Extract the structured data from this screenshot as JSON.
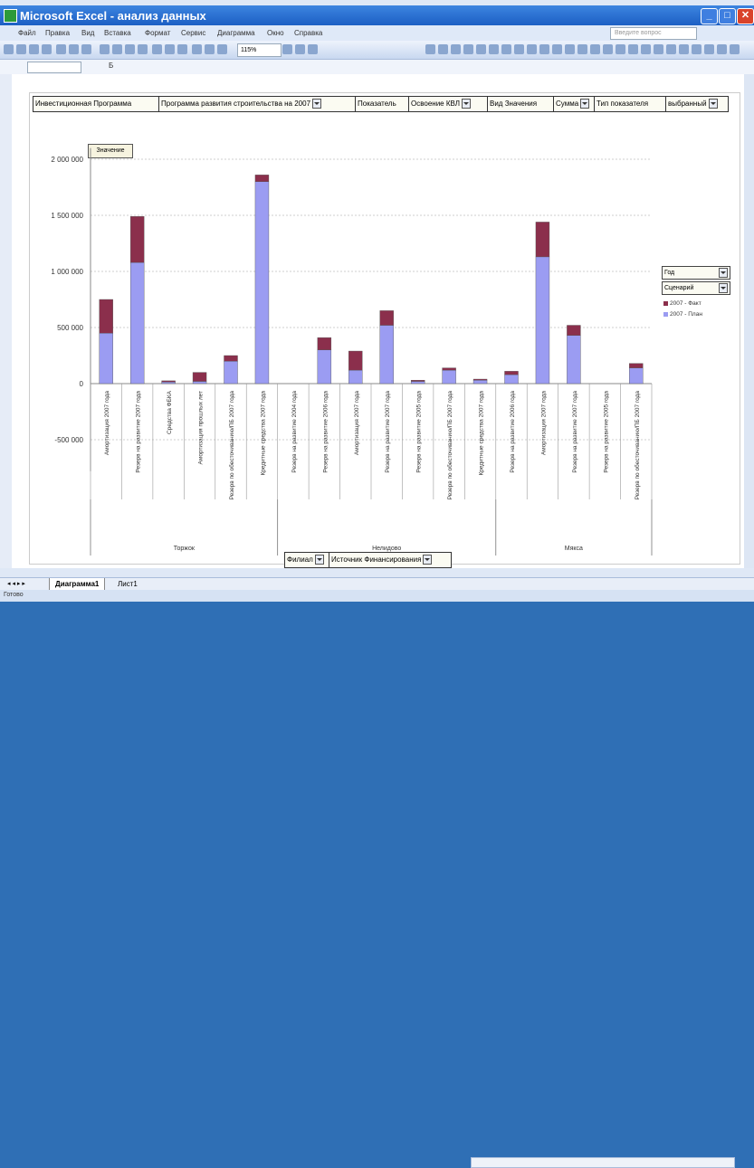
{
  "window": {
    "title": "Microsoft Excel - анализ данных"
  },
  "menu": {
    "items": [
      "Файл",
      "Правка",
      "Вид",
      "Вставка",
      "Формат",
      "Сервис",
      "Диаграмма",
      "Окно",
      "Справка"
    ],
    "help_placeholder": "Введите вопрос"
  },
  "toolbar": {
    "zoom": "115%"
  },
  "namebox": {
    "value": "",
    "col_marker": "Б"
  },
  "pivot_fields": {
    "top": [
      {
        "label": "Инвестиционная Программа",
        "dropdown": false
      },
      {
        "label": "Программа развития строительства на 2007",
        "dropdown": true
      },
      {
        "label": "Показатель",
        "dropdown": false
      },
      {
        "label": "Освоение КВЛ",
        "dropdown": true
      },
      {
        "label": "Вид Значения",
        "dropdown": false
      },
      {
        "label": "Сумма",
        "dropdown": true
      },
      {
        "label": "Тип показателя",
        "dropdown": false
      },
      {
        "label": "выбранный",
        "dropdown": true
      }
    ],
    "data_field": "Значение",
    "bottom": [
      {
        "label": "Филиал",
        "dropdown": true
      },
      {
        "label": "Источник Финансирования",
        "dropdown": true
      }
    ]
  },
  "legend": {
    "field_year": "Год",
    "field_scenario": "Сценарий",
    "entries": [
      {
        "label": "2007 - Факт",
        "color": "#8b2f4c"
      },
      {
        "label": "2007 - План",
        "color": "#9b9cf2"
      }
    ]
  },
  "chart_data": {
    "type": "bar",
    "stacked": true,
    "ylim": [
      -700000,
      2100000
    ],
    "yticks": [
      "2 000 000",
      "1 500 000",
      "1 000 000",
      "500 000",
      "0",
      "-500 000"
    ],
    "ytick_values": [
      2000000,
      1500000,
      1000000,
      500000,
      0,
      -500000
    ],
    "categories": [
      "Амортизация 2007 года",
      "Резерв на развитие 2007 года",
      "Средства ФБКА",
      "Амортизация прошлых лет",
      "Резерв по обесточиванию/ПБ 2007 года",
      "Кредитные средства 2007 года",
      "Резерв на развитие 2004 года",
      "Резерв на развитие 2006 года",
      "Амортизация 2007 года",
      "Резерв на развитие 2007 года",
      "Резерв на развитие 2005 года",
      "Резерв по обесточиванию/ПБ 2007 года",
      "Кредитные средства 2007 года",
      "Резерв на развитие 2006 года",
      "Амортизация 2007 года",
      "Резерв на развитие 2007 года",
      "Резерв на развитие 2005 года",
      "Резерв по обесточиванию/ПБ 2007 года"
    ],
    "groups": [
      {
        "name": "Торжок",
        "start": 0,
        "end": 5
      },
      {
        "name": "Нелидово",
        "start": 6,
        "end": 12
      },
      {
        "name": "Мякса",
        "start": 13,
        "end": 17
      }
    ],
    "series": [
      {
        "name": "2007 - План",
        "color": "#9b9cf2",
        "values": [
          450000,
          1080000,
          15000,
          20000,
          200000,
          1800000,
          0,
          300000,
          120000,
          520000,
          20000,
          120000,
          30000,
          80000,
          1130000,
          430000,
          0,
          140000
        ]
      },
      {
        "name": "2007 - Факт",
        "color": "#8b2f4c",
        "values": [
          300000,
          410000,
          10000,
          80000,
          50000,
          60000,
          0,
          110000,
          170000,
          130000,
          10000,
          20000,
          10000,
          30000,
          310000,
          90000,
          0,
          40000
        ]
      }
    ]
  },
  "sheet_tabs": {
    "active": "Диаграмма1",
    "other": "Лист1"
  },
  "status": "Готово"
}
